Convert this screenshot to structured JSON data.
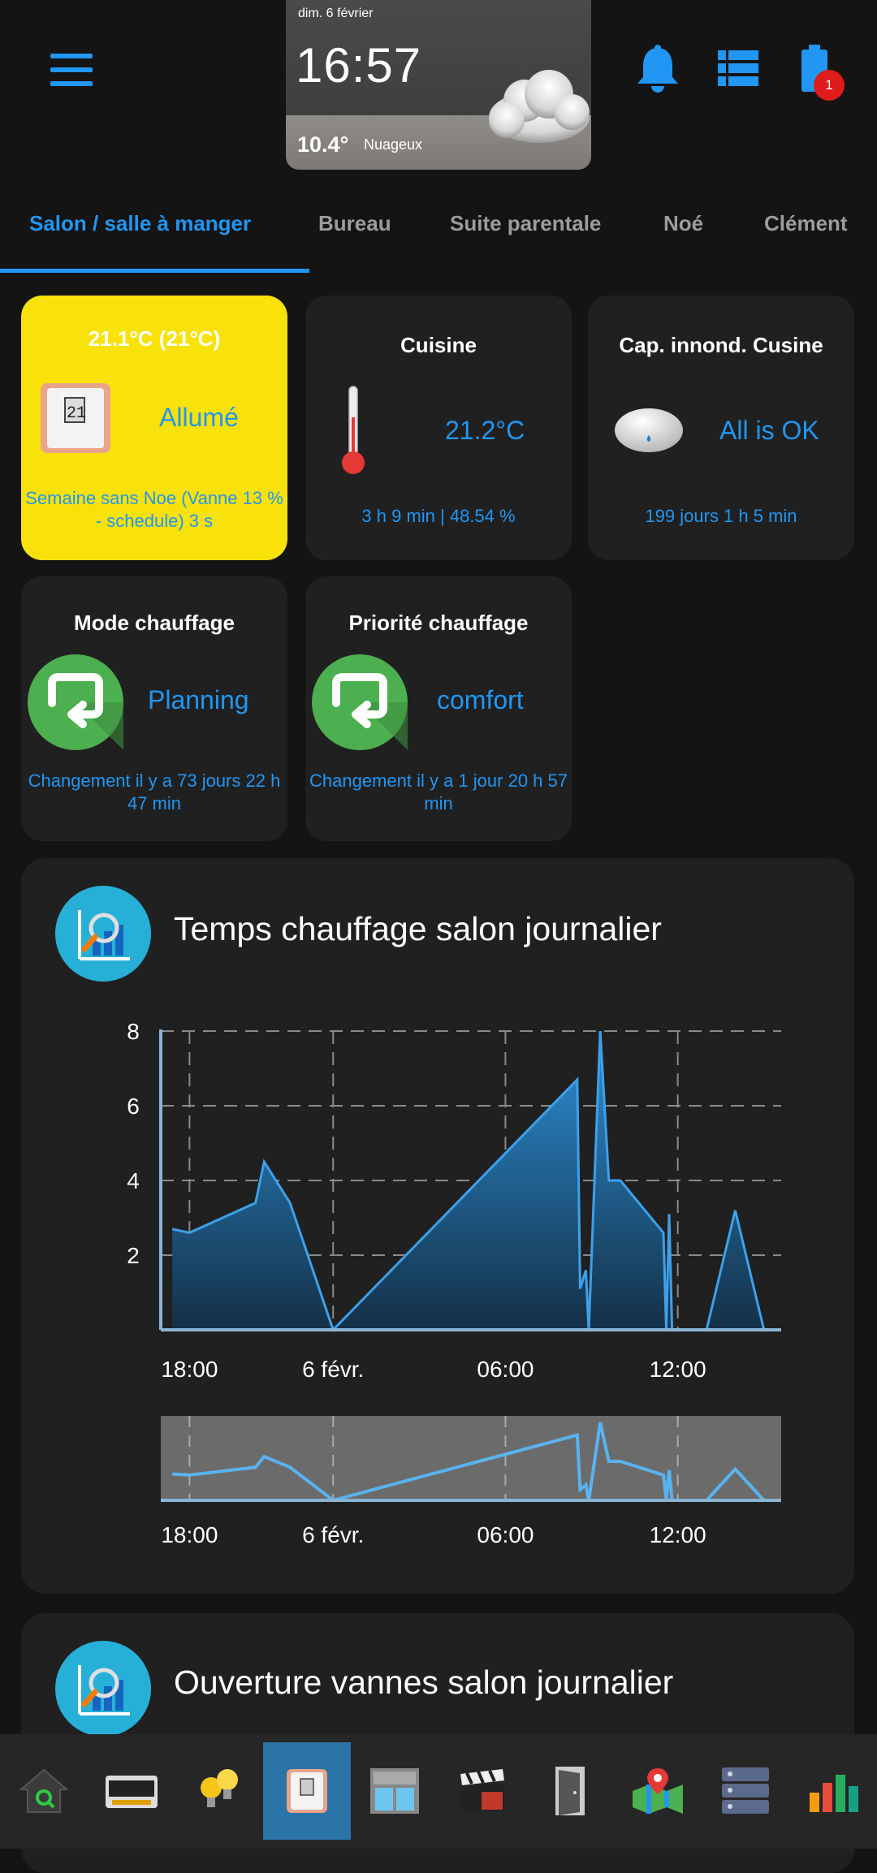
{
  "weather": {
    "date": "dim. 6 février",
    "time": "16:57",
    "temperature": "10.4°",
    "condition": "Nuageux"
  },
  "notifications": {
    "battery_badge": "1"
  },
  "tabs": [
    {
      "label": "Salon / salle à manger",
      "active": true
    },
    {
      "label": "Bureau",
      "active": false
    },
    {
      "label": "Suite parentale",
      "active": false
    },
    {
      "label": "Noé",
      "active": false
    },
    {
      "label": "Clément",
      "active": false
    }
  ],
  "cards": {
    "thermostat": {
      "title": "21.1°C (21°C)",
      "state": "Allumé",
      "detail": "Semaine sans Noe  (Vanne 13 % - schedule)  3 s",
      "bg_color": "#f8e20a"
    },
    "cuisine": {
      "title": "Cuisine",
      "value": "21.2°C",
      "detail": "3 h 9 min | 48.54 %"
    },
    "flood_sensor": {
      "title": "Cap. innond. Cusine",
      "value": "All is OK",
      "detail": "199 jours 1 h 5 min"
    },
    "heating_mode": {
      "title": "Mode chauffage",
      "value": "Planning",
      "detail": "Changement il y a 73 jours 22 h 47 min"
    },
    "heating_priority": {
      "title": "Priorité chauffage",
      "value": "comfort",
      "detail": "Changement il y a 1 jour 20 h 57 min"
    }
  },
  "chart_section": {
    "title": "Temps chauffage salon journalier"
  },
  "chart_data": {
    "type": "area",
    "title": "Temps chauffage salon journalier",
    "xlabel": "",
    "ylabel": "",
    "x_ticks": [
      "18:00",
      "6 févr.",
      "06:00",
      "12:00"
    ],
    "y_ticks": [
      2,
      4,
      6,
      8
    ],
    "ylim": [
      0,
      8
    ],
    "x_unit": "hours since 17:00 on 5 févr.",
    "x": [
      0.4,
      1.0,
      3.3,
      3.6,
      4.5,
      6.0,
      14.5,
      14.6,
      14.8,
      14.9,
      15.3,
      15.6,
      16.0,
      17.5,
      17.6,
      17.7,
      17.8,
      17.9,
      19.0,
      20.0,
      21.0
    ],
    "y": [
      2.7,
      2.6,
      3.4,
      4.5,
      3.4,
      0.0,
      6.7,
      1.1,
      1.6,
      0.0,
      8.0,
      4.0,
      4.0,
      2.6,
      0.0,
      3.1,
      0.0,
      0.0,
      0.0,
      3.2,
      0.0
    ],
    "grid": true,
    "navigator": {
      "x_ticks": [
        "18:00",
        "6 févr.",
        "06:00",
        "12:00"
      ]
    },
    "color": "#2c8fd6"
  },
  "chart_section2": {
    "title": "Ouverture vannes salon journalier"
  },
  "bottom_nav": [
    {
      "icon": "home-search-icon",
      "active": false
    },
    {
      "icon": "tv-box-icon",
      "active": false
    },
    {
      "icon": "light-bulbs-icon",
      "active": false
    },
    {
      "icon": "thermostat-icon",
      "active": true
    },
    {
      "icon": "window-shutter-icon",
      "active": false
    },
    {
      "icon": "clapperboard-icon",
      "active": false
    },
    {
      "icon": "door-icon",
      "active": false
    },
    {
      "icon": "map-pin-icon",
      "active": false
    },
    {
      "icon": "server-icon",
      "active": false
    },
    {
      "icon": "bar-chart-icon",
      "active": false
    }
  ]
}
